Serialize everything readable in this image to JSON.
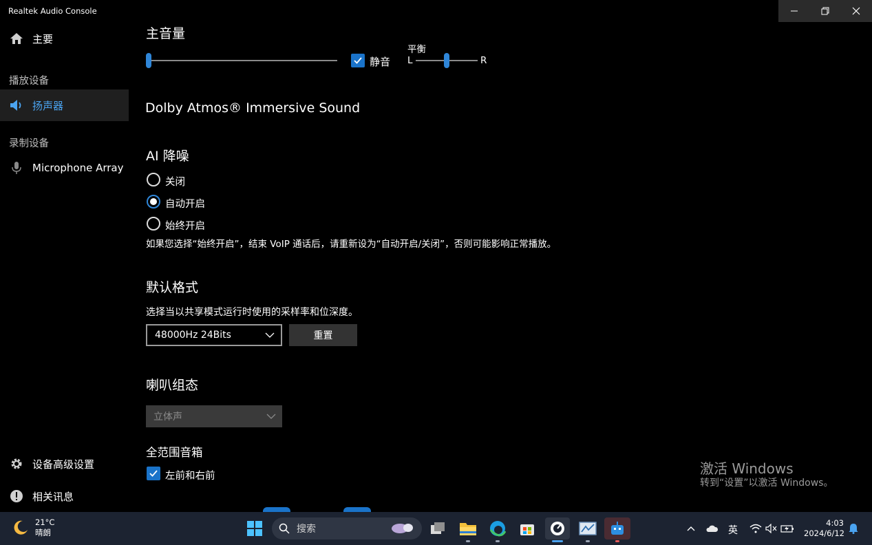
{
  "window": {
    "title": "Realtek Audio Console"
  },
  "sidebar": {
    "home": {
      "label": "主要",
      "icon": "home-icon"
    },
    "playback_section": "播放设备",
    "speaker": {
      "label": "扬声器",
      "icon": "speaker-icon"
    },
    "recording_section": "录制设备",
    "microphone": {
      "label": "Microphone Array",
      "icon": "microphone-icon"
    },
    "advanced": {
      "label": "设备高级设置",
      "icon": "gear-icon"
    },
    "info": {
      "label": "相关讯息",
      "icon": "info-icon"
    }
  },
  "main_volume": {
    "title": "主音量",
    "volume_level": 0,
    "mute_label": "静音",
    "mute_checked": true,
    "balance_label": "平衡",
    "balance_left": "L",
    "balance_right": "R",
    "balance_level": 0.5
  },
  "dolby": {
    "title": "Dolby Atmos® Immersive Sound"
  },
  "ai_noise": {
    "title": "AI 降噪",
    "options": [
      {
        "label": "关闭",
        "selected": false
      },
      {
        "label": "自动开启",
        "selected": true
      },
      {
        "label": "始终开启",
        "selected": false
      }
    ],
    "note": "如果您选择“始终开启”，结束 VoIP 通话后，请重新设为“自动开启/关闭”，否则可能影响正常播放。"
  },
  "default_format": {
    "title": "默认格式",
    "description": "选择当以共享模式运行时使用的采样率和位深度。",
    "selected": "48000Hz 24Bits",
    "reset_label": "重置"
  },
  "speaker_config": {
    "title": "喇叭组态",
    "selected": "立体声"
  },
  "full_range": {
    "title": "全范围音箱",
    "option_label": "左前和右前",
    "checked": true
  },
  "activation": {
    "title": "激活 Windows",
    "subtitle": "转到“设置”以激活 Windows。"
  },
  "taskbar": {
    "weather_temp": "21°C",
    "weather_desc": "晴朗",
    "search_placeholder": "搜索",
    "ime": "英",
    "time": "4:03",
    "date": "2024/6/12"
  }
}
